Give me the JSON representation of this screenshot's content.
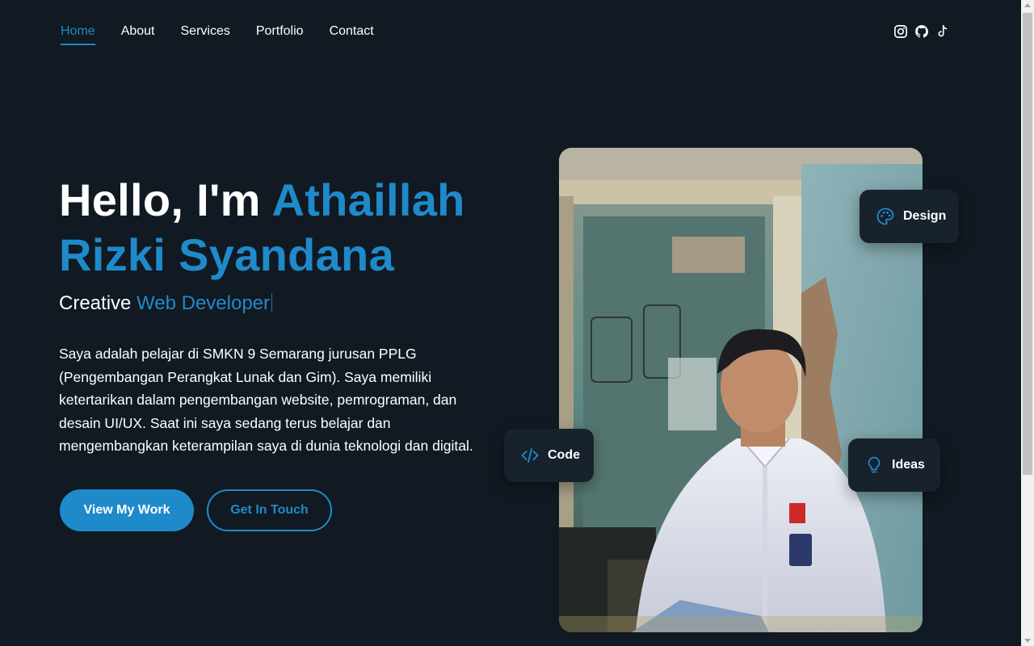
{
  "nav": {
    "links": [
      {
        "label": "Home",
        "active": true
      },
      {
        "label": "About",
        "active": false
      },
      {
        "label": "Services",
        "active": false
      },
      {
        "label": "Portfolio",
        "active": false
      },
      {
        "label": "Contact",
        "active": false
      }
    ],
    "socials": [
      "instagram-icon",
      "github-icon",
      "tiktok-icon"
    ]
  },
  "hero": {
    "greeting": "Hello, I'm ",
    "name_line1": "Athaillah",
    "name_line2": "Rizki Syandana",
    "subtitle_prefix": "Creative ",
    "subtitle_accent": "Web Developer",
    "description": "Saya adalah pelajar di SMKN 9 Semarang jurusan PPLG (Pengembangan Perangkat Lunak dan Gim). Saya memiliki ketertarikan dalam pengembangan website, pemrograman, dan desain UI/UX. Saat ini saya sedang terus belajar dan mengembangkan keterampilan saya di dunia teknologi dan digital.",
    "primary_button": "View My Work",
    "secondary_button": "Get In Touch"
  },
  "chips": {
    "design": "Design",
    "code": "Code",
    "ideas": "Ideas"
  },
  "colors": {
    "background": "#111922",
    "accent": "#1f8ac9",
    "chip_bg": "#17222d"
  }
}
